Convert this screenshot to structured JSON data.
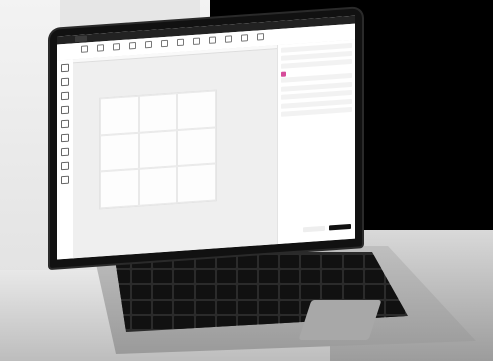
{
  "scene": {
    "description_free": true
  },
  "app": {
    "tab_label": "",
    "toolbar_items": [
      "",
      "",
      "",
      "",
      "",
      "",
      "",
      "",
      "",
      "",
      "",
      ""
    ],
    "left_tools": [
      "",
      "",
      "",
      "",
      "",
      "",
      "",
      "",
      ""
    ],
    "panel": {
      "section_processing": "",
      "section_laser": ""
    },
    "colors": {
      "accent": "#d64b9a",
      "primary_button": "#111111"
    }
  }
}
